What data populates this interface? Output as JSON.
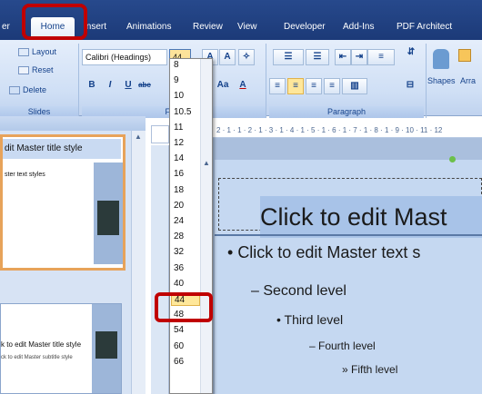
{
  "tabs": [
    "er",
    "Home",
    "Insert",
    "Animations",
    "Review",
    "View",
    "Developer",
    "Add-Ins",
    "PDF Architect"
  ],
  "slides_group": {
    "layout_label": "Layout",
    "reset_label": "Reset",
    "delete_label": "Delete",
    "group_label": "Slides"
  },
  "font_group": {
    "font_name": "Calibri (Headings)",
    "font_size": "44",
    "group_label": "Fo"
  },
  "paragraph_group": {
    "group_label": "Paragraph"
  },
  "drawing_group": {
    "shapes_label": "Shapes",
    "arrange_label": "Arra"
  },
  "font_sizes": [
    "8",
    "9",
    "10",
    "10.5",
    "11",
    "12",
    "14",
    "16",
    "18",
    "20",
    "24",
    "28",
    "32",
    "36",
    "40",
    "44",
    "48",
    "54",
    "60",
    "66"
  ],
  "selected_font_size": "44",
  "highlighted_font_size": "40",
  "thumbnails": {
    "thumb1_title": "dit Master title style",
    "thumb1_sub": "ster text styles",
    "thumb2_title": "k to edit Master title style",
    "thumb2_sub": "ck to edit Master subtitle style"
  },
  "ruler_ticks": "2 · 1 · 1 · 2 · 1 · 3 · 1 · 4 · 1 · 5 · 1 · 6 · 1 · 7 · 1 · 8 · 1 · 9 · 10 · 11 · 12",
  "slide": {
    "title": "Click to edit Mast",
    "level1": "Click to edit Master text s",
    "level2": "– Second level",
    "level3": "Third level",
    "level4": "– Fourth level",
    "level5": "» Fifth level"
  },
  "colors": {
    "highlight": "#c00000",
    "ribbon_top": "#27498c",
    "selected_item": "#ffe79a"
  }
}
